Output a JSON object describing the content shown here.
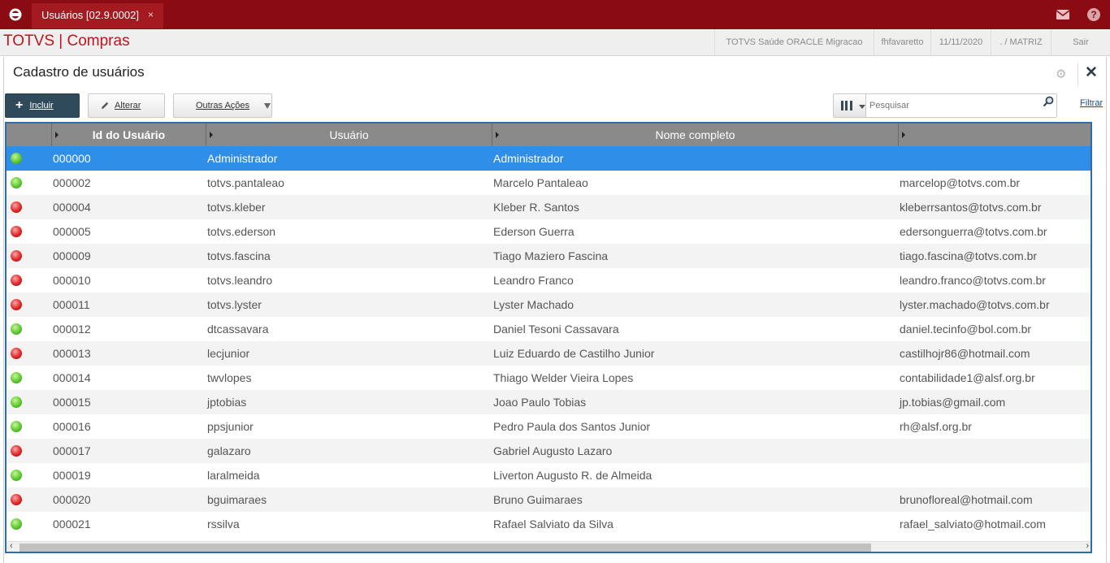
{
  "topbar": {
    "tab_title": "Usuários [02.9.0002]",
    "tab_close": "×",
    "help_glyph": "?"
  },
  "header": {
    "app_title": "TOTVS | Compras",
    "environment": "TOTVS Saúde ORACLE Migracao",
    "user": "fhfavaretto",
    "date": "11/11/2020",
    "branch": ". / MATRIZ",
    "logout": "Sair"
  },
  "page": {
    "title": "Cadastro de usuários",
    "close_glyph": "✕",
    "settings_glyph": "⚙"
  },
  "toolbar": {
    "incluir_label": "Incluir",
    "alterar_label": "Alterar",
    "outras_label": "Outras Ações",
    "search_placeholder": "Pesquisar",
    "filtrar_label": "Filtrar"
  },
  "colors": {
    "topbar": "#8a0b12",
    "brand_red": "#c4131c",
    "selected_row": "#2e8ee8",
    "grid_border": "#2d6dab",
    "primary_button": "#2f4a5a"
  },
  "grid": {
    "columns": [
      "Id do Usuário",
      "Usuário",
      "Nome completo",
      ""
    ],
    "rows": [
      {
        "status": "green",
        "id": "000000",
        "user": "Administrador",
        "name": "Administrador",
        "email": ""
      },
      {
        "status": "green",
        "id": "000002",
        "user": "totvs.pantaleao",
        "name": "Marcelo Pantaleao",
        "email": "marcelop@totvs.com.br"
      },
      {
        "status": "red",
        "id": "000004",
        "user": "totvs.kleber",
        "name": "Kleber R. Santos",
        "email": "kleberrsantos@totvs.com.br"
      },
      {
        "status": "red",
        "id": "000005",
        "user": "totvs.ederson",
        "name": "Ederson Guerra",
        "email": "edersonguerra@totvs.com.br"
      },
      {
        "status": "red",
        "id": "000009",
        "user": "totvs.fascina",
        "name": "Tiago Maziero Fascina",
        "email": "tiago.fascina@totvs.com.br"
      },
      {
        "status": "red",
        "id": "000010",
        "user": "totvs.leandro",
        "name": "Leandro Franco",
        "email": "leandro.franco@totvs.com.br"
      },
      {
        "status": "red",
        "id": "000011",
        "user": "totvs.lyster",
        "name": "Lyster Machado",
        "email": "lyster.machado@totvs.com.br"
      },
      {
        "status": "green",
        "id": "000012",
        "user": "dtcassavara",
        "name": "Daniel Tesoni Cassavara",
        "email": "daniel.tecinfo@bol.com.br"
      },
      {
        "status": "red",
        "id": "000013",
        "user": "lecjunior",
        "name": "Luiz Eduardo de Castilho Junior",
        "email": "castilhojr86@hotmail.com"
      },
      {
        "status": "green",
        "id": "000014",
        "user": "twvlopes",
        "name": "Thiago Welder Vieira Lopes",
        "email": "contabilidade1@alsf.org.br"
      },
      {
        "status": "green",
        "id": "000015",
        "user": "jptobias",
        "name": "Joao Paulo Tobias",
        "email": "jp.tobias@gmail.com"
      },
      {
        "status": "green",
        "id": "000016",
        "user": "ppsjunior",
        "name": "Pedro Paula dos Santos Junior",
        "email": "rh@alsf.org.br"
      },
      {
        "status": "red",
        "id": "000017",
        "user": "galazaro",
        "name": "Gabriel Augusto Lazaro",
        "email": ""
      },
      {
        "status": "green",
        "id": "000019",
        "user": "laralmeida",
        "name": "Liverton Augusto R. de Almeida",
        "email": ""
      },
      {
        "status": "red",
        "id": "000020",
        "user": "bguimaraes",
        "name": "Bruno Guimaraes",
        "email": "brunofloreal@hotmail.com"
      },
      {
        "status": "green",
        "id": "000021",
        "user": "rssilva",
        "name": "Rafael Salviato da Silva",
        "email": "rafael_salviato@hotmail.com"
      }
    ]
  }
}
